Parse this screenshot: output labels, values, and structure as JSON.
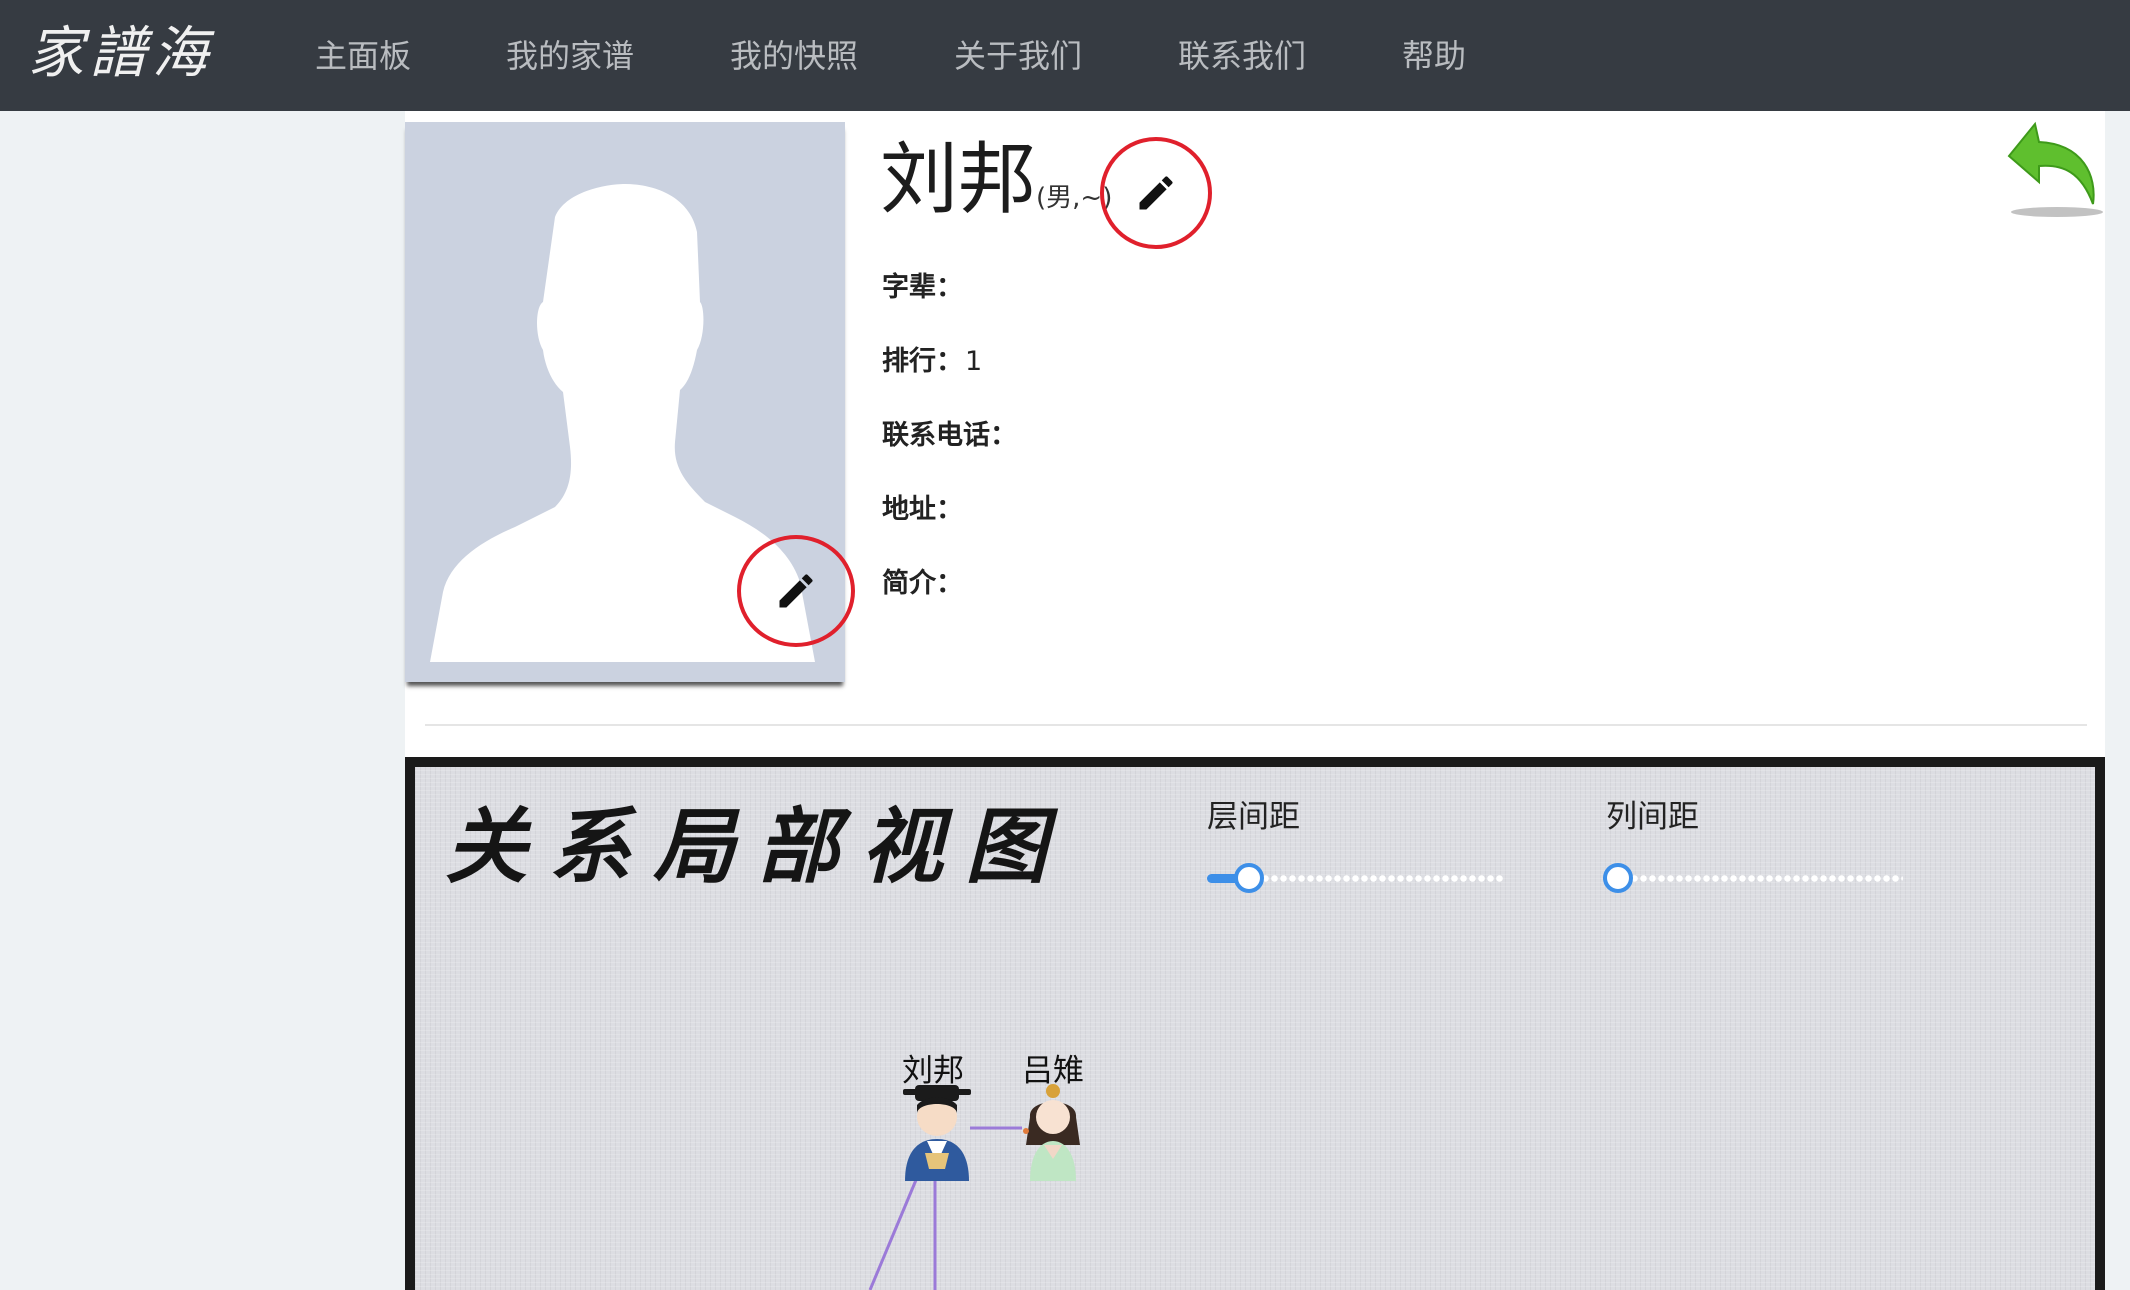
{
  "app": {
    "logo": "家譜海"
  },
  "nav": {
    "items": [
      {
        "label": "主面板"
      },
      {
        "label": "我的家谱"
      },
      {
        "label": "我的快照"
      },
      {
        "label": "关于我们"
      },
      {
        "label": "联系我们"
      },
      {
        "label": "帮助"
      }
    ]
  },
  "profile": {
    "name": "刘邦",
    "meta": "(男,~)",
    "fields": [
      {
        "label": "字辈：",
        "value": ""
      },
      {
        "label": "排行：",
        "value": "1"
      },
      {
        "label": "联系电话：",
        "value": ""
      },
      {
        "label": "地址：",
        "value": ""
      },
      {
        "label": "简介：",
        "value": ""
      }
    ]
  },
  "relation_view": {
    "title": "关系局部视图",
    "sliders": [
      {
        "label": "层间距",
        "value": 0.1
      },
      {
        "label": "列间距",
        "value": 0.0
      }
    ],
    "people": [
      {
        "name": "刘邦"
      },
      {
        "name": "吕雉"
      }
    ]
  },
  "colors": {
    "nav_bg": "#363b42",
    "accent": "#3d8fe8",
    "edit_highlight": "#e0202c",
    "back_arrow": "#5fbf2e"
  },
  "icons": {
    "photo_edit": "pencil-icon",
    "name_edit": "pencil-icon",
    "back": "undo-arrow-icon"
  }
}
